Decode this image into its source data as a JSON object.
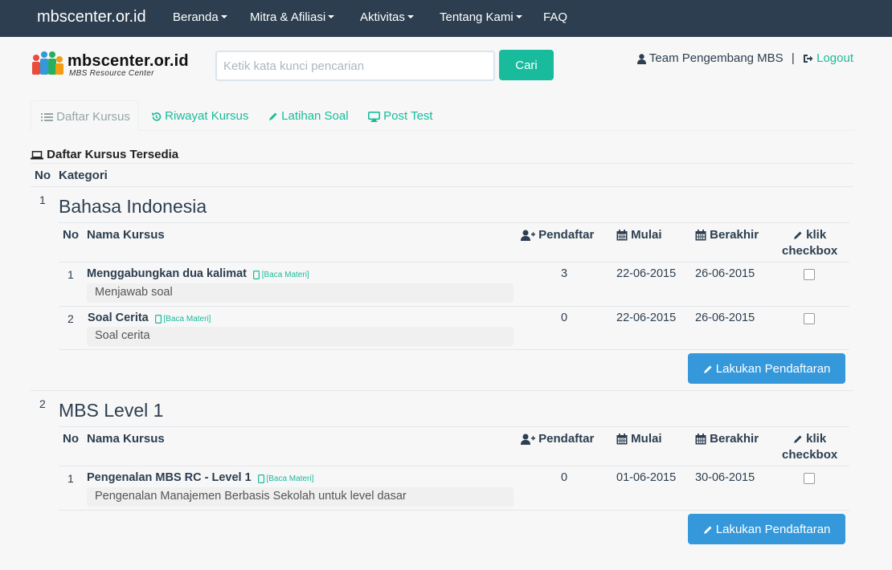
{
  "navbar": {
    "brand": "mbscenter.or.id",
    "items": [
      {
        "label": "Beranda",
        "dropdown": true
      },
      {
        "label": "Mitra & Afiliasi",
        "dropdown": true
      },
      {
        "label": "Aktivitas",
        "dropdown": true
      },
      {
        "label": "Tentang Kami",
        "dropdown": true
      },
      {
        "label": "FAQ",
        "dropdown": false
      }
    ]
  },
  "header": {
    "logo_text": "mbscenter.or.id",
    "logo_sub": "MBS Resource Center",
    "search_placeholder": "Ketik kata kunci pencarian",
    "search_button": "Cari",
    "user_name": "Team Pengembang MBS",
    "separator": "|",
    "logout": "Logout"
  },
  "tabs": [
    {
      "label": "Daftar Kursus",
      "icon": "list-icon",
      "active": true
    },
    {
      "label": "Riwayat Kursus",
      "icon": "history-icon",
      "active": false
    },
    {
      "label": "Latihan Soal",
      "icon": "pencil-icon",
      "active": false
    },
    {
      "label": "Post Test",
      "icon": "desktop-icon",
      "active": false
    }
  ],
  "section": {
    "title": "Daftar Kursus Tersedia",
    "col_no": "No",
    "col_kategori": "Kategori"
  },
  "course_table_headers": {
    "no": "No",
    "nama": "Nama Kursus",
    "pendaftar": "Pendaftar",
    "mulai": "Mulai",
    "berakhir": "Berakhir",
    "klik": "klik",
    "checkbox": "checkbox"
  },
  "categories": [
    {
      "no": "1",
      "name": "Bahasa Indonesia",
      "courses": [
        {
          "no": "1",
          "name": "Menggabungkan dua kalimat",
          "baca": "[Baca Materi]",
          "desc": "Menjawab soal",
          "pendaftar": "3",
          "mulai": "22-06-2015",
          "berakhir": "26-06-2015",
          "checked": false
        },
        {
          "no": "2",
          "name": "Soal Cerita",
          "baca": "[Baca Materi]",
          "desc": "Soal cerita",
          "pendaftar": "0",
          "mulai": "22-06-2015",
          "berakhir": "26-06-2015",
          "checked": false
        }
      ],
      "register_button": "Lakukan Pendaftaran"
    },
    {
      "no": "2",
      "name": "MBS Level 1",
      "courses": [
        {
          "no": "1",
          "name": "Pengenalan MBS RC - Level 1",
          "baca": "[Baca Materi]",
          "desc": "Pengenalan Manajemen Berbasis Sekolah untuk level dasar",
          "pendaftar": "0",
          "mulai": "01-06-2015",
          "berakhir": "30-06-2015",
          "checked": false
        }
      ],
      "register_button": "Lakukan Pendaftaran"
    }
  ],
  "colors": {
    "navbar": "#2c3e50",
    "accent": "#18bc9c",
    "primary_button": "#3498db",
    "text": "#2c3e50"
  }
}
